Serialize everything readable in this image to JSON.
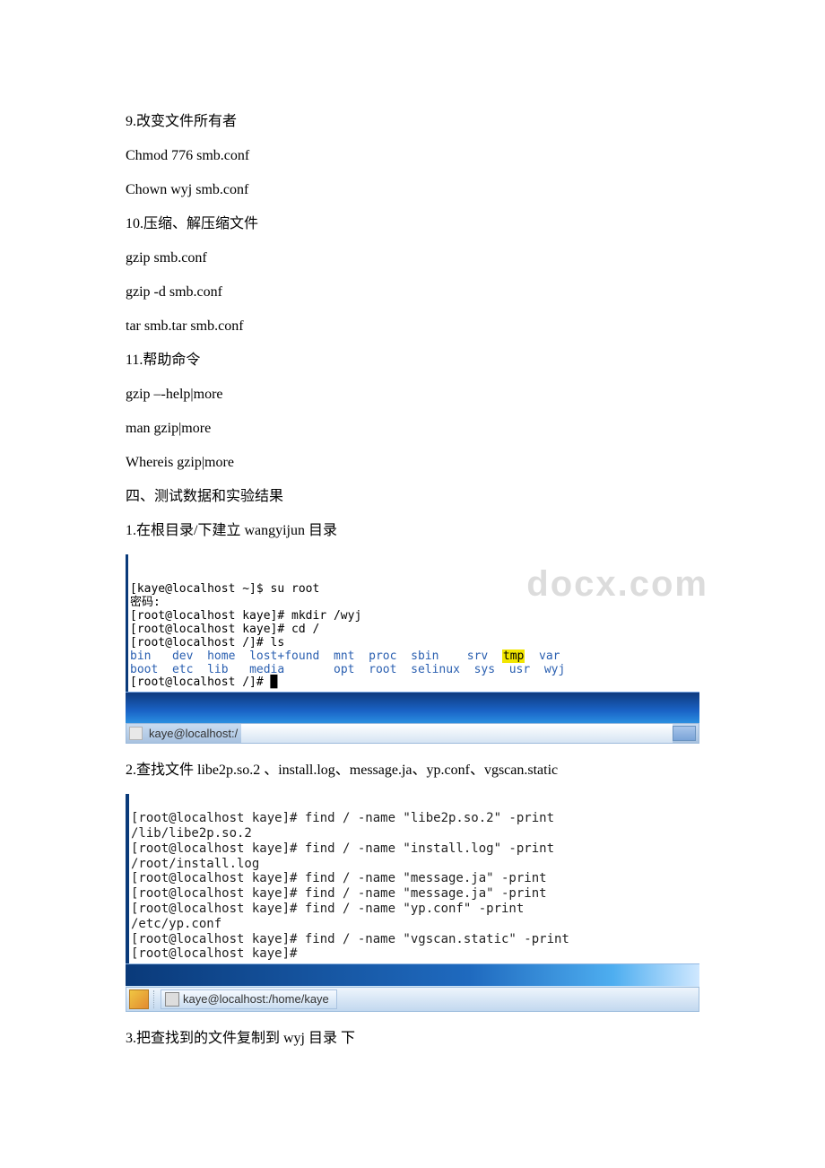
{
  "doc": {
    "line1": "9.改变文件所有者",
    "line2": "Chmod 776 smb.conf",
    "line3": "Chown wyj smb.conf",
    "line4": "10.压缩、解压缩文件",
    "line5": "gzip smb.conf",
    "line6": "gzip -d smb.conf",
    "line7": "tar smb.tar smb.conf",
    "line8": "11.帮助命令",
    "line9": "gzip –-help|more",
    "line10": "man gzip|more",
    "line11": "Whereis gzip|more",
    "line12": "四、测试数据和实验结果",
    "line13": "1.在根目录/下建立 wangyijun 目录",
    "line14": "2.查找文件 libe2p.so.2 、install.log、message.ja、yp.conf、vgscan.static",
    "line15": "3.把查找到的文件复制到 wyj 目录 下"
  },
  "watermark": "docx.com",
  "terminal1": {
    "l1": "[kaye@localhost ~]$ su root",
    "l2": "密码:",
    "l3": "[root@localhost kaye]# mkdir /wyj",
    "l4": "[root@localhost kaye]# cd /",
    "l5": "[root@localhost /]# ls",
    "ls_row1": {
      "c1": "bin",
      "c2": "dev",
      "c3": "home",
      "c4": "lost+found",
      "c5": "mnt",
      "c6": "proc",
      "c7": "sbin",
      "c8": "srv",
      "c9": "tmp",
      "c10": "var"
    },
    "ls_row2": {
      "c1": "boot",
      "c2": "etc",
      "c3": "lib",
      "c4": "media",
      "c5": "opt",
      "c6": "root",
      "c7": "selinux",
      "c8": "sys",
      "c9": "usr",
      "c10": "wyj"
    },
    "l8": "[root@localhost /]# "
  },
  "taskbar1": {
    "label": "kaye@localhost:/"
  },
  "terminal2": {
    "l1": "[root@localhost kaye]# find / -name \"libe2p.so.2\" -print",
    "l2": "/lib/libe2p.so.2",
    "l3": "[root@localhost kaye]# find / -name \"install.log\" -print",
    "l4": "/root/install.log",
    "l5": "[root@localhost kaye]# find / -name \"message.ja\" -print",
    "l6": "[root@localhost kaye]# find / -name \"message.ja\" -print",
    "l7": "[root@localhost kaye]# find / -name \"yp.conf\" -print",
    "l8": "/etc/yp.conf",
    "l9": "[root@localhost kaye]# find / -name \"vgscan.static\" -print",
    "l10": "[root@localhost kaye]#"
  },
  "taskbar2": {
    "label": "kaye@localhost:/home/kaye"
  }
}
